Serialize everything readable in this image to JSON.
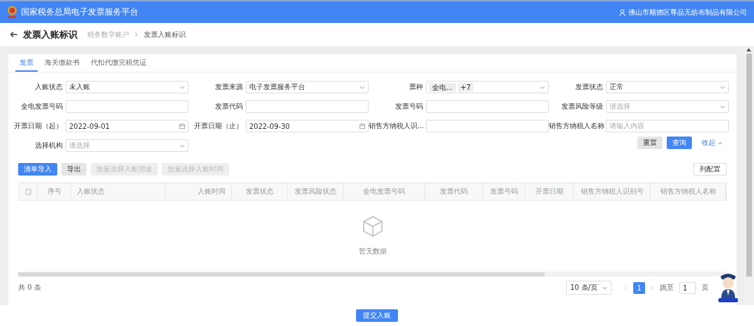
{
  "header": {
    "title": "国家税务总局电子发票服务平台",
    "user": "佛山市顺德区尊品无纺布制品有限公司"
  },
  "page": {
    "title": "发票入账标识",
    "breadcrumb": [
      "税务数字账户",
      "发票入账标识"
    ]
  },
  "tabs": [
    {
      "label": "发票",
      "selected": true
    },
    {
      "label": "海关缴款书",
      "selected": false
    },
    {
      "label": "代扣代缴完税凭证",
      "selected": false
    }
  ],
  "filters": [
    {
      "label": "入账状态",
      "kind": "select",
      "value": "未入账"
    },
    {
      "label": "发票来源",
      "kind": "select",
      "value": "电子发票服务平台"
    },
    {
      "label": "票种",
      "kind": "tags",
      "tags": [
        "全电...",
        "+7"
      ]
    },
    {
      "label": "发票状态",
      "kind": "select",
      "value": "正常"
    },
    {
      "label": "全电发票号码",
      "kind": "input"
    },
    {
      "label": "发票代码",
      "kind": "input"
    },
    {
      "label": "发票号码",
      "kind": "input"
    },
    {
      "label": "发票风险等级",
      "kind": "select",
      "placeholder": "请选择"
    },
    {
      "label": "开票日期（起）",
      "kind": "date",
      "value": "2022-09-01"
    },
    {
      "label": "开票日期（止）",
      "kind": "date",
      "value": "2022-09-30"
    },
    {
      "label": "销售方纳税人识...",
      "kind": "input"
    },
    {
      "label": "销售方纳税人名称",
      "kind": "input",
      "placeholder": "请输入内容"
    },
    {
      "label": "选择机构",
      "kind": "select",
      "placeholder": "请选择"
    }
  ],
  "filter_actions": {
    "reset": "重置",
    "query": "查询",
    "collapse": "收起"
  },
  "toolbar": {
    "buttons": [
      {
        "label": "清单导入",
        "kind": "primary"
      },
      {
        "label": "导出",
        "kind": "default"
      },
      {
        "label": "批量选择入账用途",
        "kind": "disabled"
      },
      {
        "label": "批量选择入账时间",
        "kind": "disabled"
      }
    ],
    "column_config": "列配置"
  },
  "table": {
    "select_all": {
      "checked": false,
      "disabled": true
    },
    "columns": [
      "序号",
      "入账状态",
      "入账时间",
      "发票状态",
      "发票风险状态",
      "全电发票号码",
      "发票代码",
      "发票号码",
      "开票日期",
      "销售方纳税人识别号",
      "销售方纳税人名称"
    ],
    "empty_text": "暂无数据"
  },
  "pagination": {
    "total": "共 0 条",
    "page_size": "10 条/页",
    "pages": [
      {
        "label": "1",
        "selected": true
      }
    ],
    "jump_label": "跳至",
    "jump_value": "1",
    "page_unit": "页"
  },
  "submit_button": "提交入账"
}
